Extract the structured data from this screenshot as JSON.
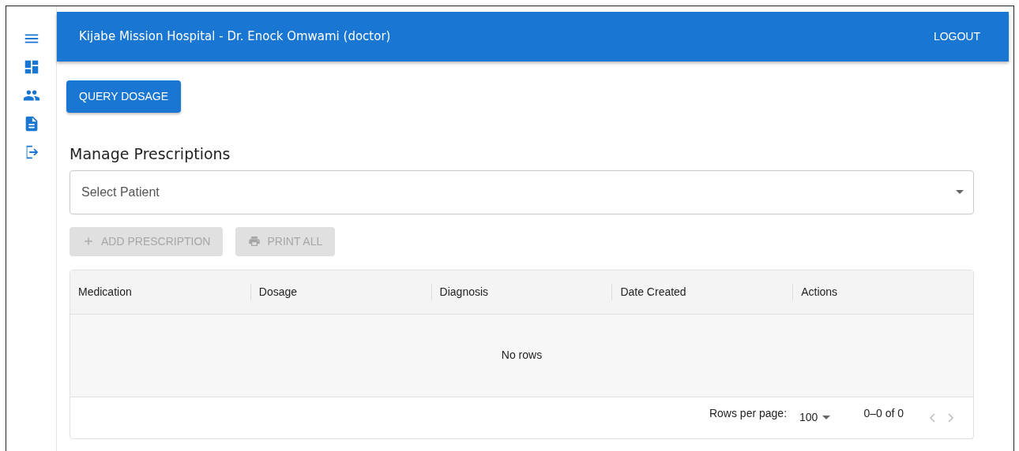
{
  "header": {
    "title": "Kijabe Mission Hospital - Dr. Enock Omwami (doctor)",
    "logout": "LOGOUT"
  },
  "query_button": "QUERY DOSAGE",
  "section_title": "Manage Prescriptions",
  "patient_select": {
    "placeholder": "Select Patient"
  },
  "actions": [
    {
      "kind": "add",
      "label": "ADD PRESCRIPTION",
      "disabled": true
    },
    {
      "kind": "print",
      "label": "PRINT ALL",
      "disabled": true
    }
  ],
  "table": {
    "columns": [
      "Medication",
      "Dosage",
      "Diagnosis",
      "Date Created",
      "Actions"
    ],
    "empty_message": "No rows"
  },
  "pagination": {
    "rows_per_page_label": "Rows per page:",
    "rows_per_page": "100",
    "range": "0–0 of 0",
    "prev_disabled": true,
    "next_disabled": true
  }
}
